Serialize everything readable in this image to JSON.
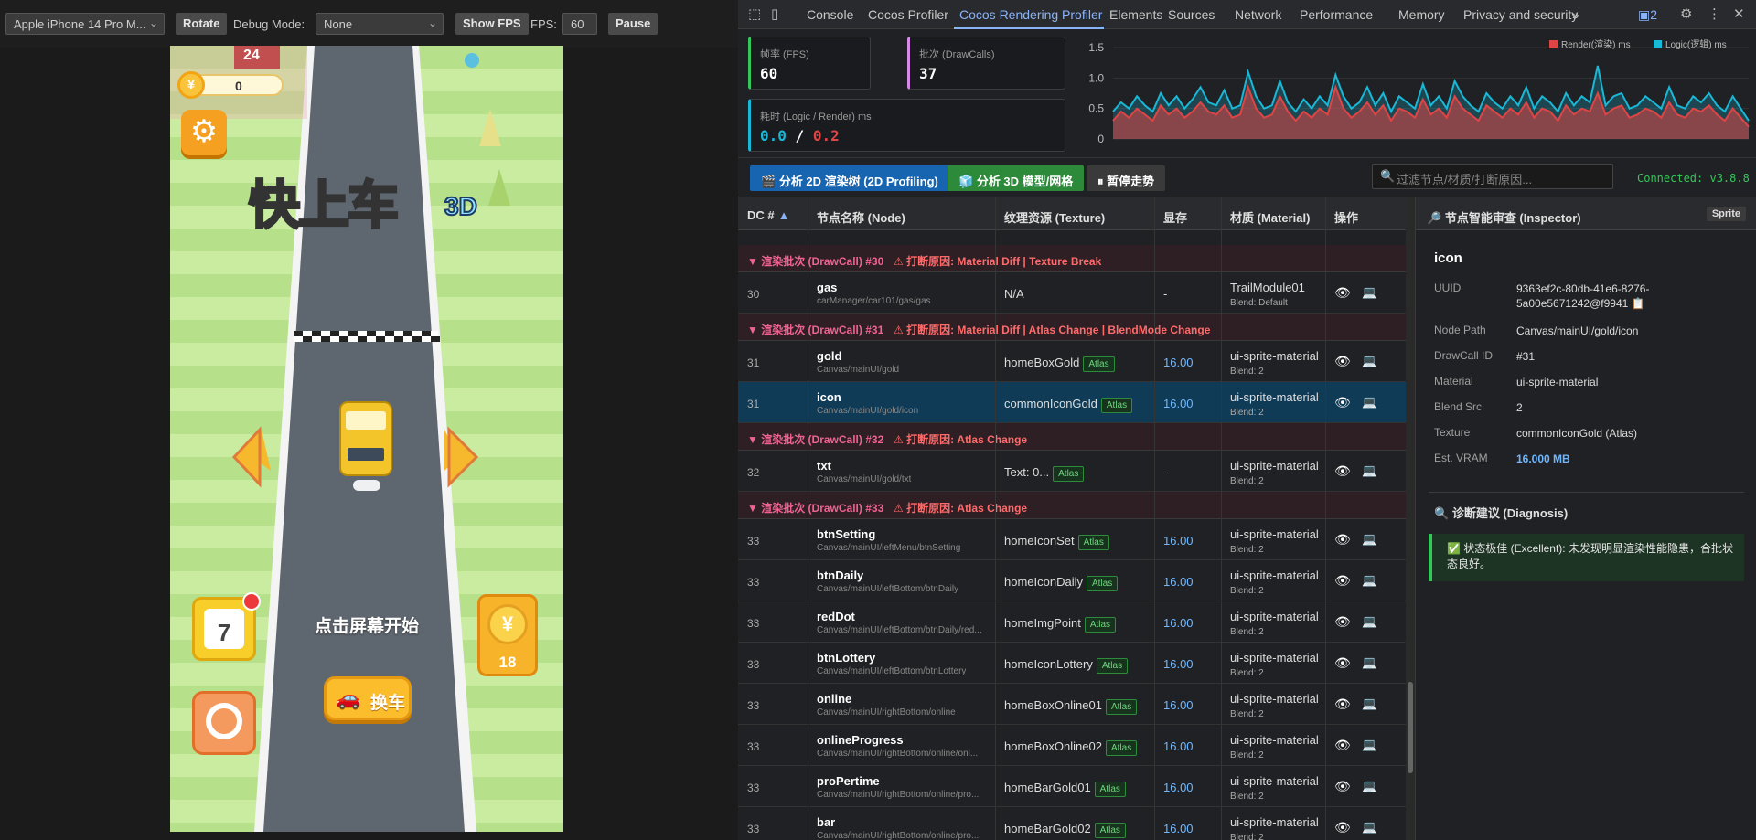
{
  "simulator": {
    "device": "Apple iPhone 14 Pro M...",
    "rotate_label": "Rotate",
    "debug_label": "Debug Mode:",
    "debug_value": "None",
    "show_fps_label": "Show FPS",
    "fps_label": "FPS:",
    "fps_value": "60",
    "pause_label": "Pause"
  },
  "game": {
    "coins": "0",
    "coin_symbol": "¥",
    "title": "快上车",
    "title_3d": "3D",
    "start_tip": "点击屏幕开始",
    "calendar_day": "7",
    "coin_panel_count": "18",
    "change_car_label": "换车",
    "building_number": "24"
  },
  "devtools": {
    "tabs": [
      "Console",
      "Cocos Profiler",
      "Cocos Rendering Profiler",
      "Elements",
      "Sources",
      "Network",
      "Performance",
      "Memory",
      "Privacy and security"
    ],
    "more": "»",
    "issues_count": "2",
    "metrics": {
      "fps_label": "帧率 (FPS)",
      "fps_value": "60",
      "dc_label": "批次 (DrawCalls)",
      "dc_value": "37",
      "time_label": "耗时 (Logic / Render) ms",
      "logic_value": "0.0",
      "sep": "/",
      "render_value": "0.2"
    },
    "chart_legend": {
      "render": "Render(渲染) ms",
      "logic": "Logic(逻辑) ms"
    },
    "toolbar": {
      "btn_2d": "分析 2D 渲染树 (2D Profiling)",
      "btn_3d": "分析 3D 模型/网格",
      "btn_pause": "暂停走势",
      "filter_placeholder": "过滤节点/材质/打断原因...",
      "connected": "Connected: v3.8.8"
    },
    "table": {
      "headers": [
        "DC #",
        "节点名称 (Node)",
        "纹理资源 (Texture)",
        "显存",
        "材质 (Material)",
        "操作"
      ],
      "sort_arrow": "▲",
      "atlas_tag": "Atlas",
      "groups": [
        {
          "title": "▼ 渲染批次 (DrawCall) #30",
          "reason": "⚠ 打断原因: Material Diff | Texture Break",
          "rows": [
            {
              "dc": "30",
              "name": "gas",
              "path": "carManager/car101/gas/gas",
              "texture": "N/A",
              "atlas": false,
              "vram": "-",
              "material": "TrailModule01",
              "blend": "Blend: Default"
            }
          ]
        },
        {
          "title": "▼ 渲染批次 (DrawCall) #31",
          "reason": "⚠ 打断原因: Material Diff | Atlas Change | BlendMode Change",
          "rows": [
            {
              "dc": "31",
              "name": "gold",
              "path": "Canvas/mainUI/gold",
              "texture": "homeBoxGold",
              "atlas": true,
              "vram": "16.00",
              "material": "ui-sprite-material",
              "blend": "Blend: 2"
            },
            {
              "dc": "31",
              "name": "icon",
              "path": "Canvas/mainUI/gold/icon",
              "texture": "commonIconGold",
              "atlas": true,
              "vram": "16.00",
              "material": "ui-sprite-material",
              "blend": "Blend: 2",
              "selected": true
            }
          ]
        },
        {
          "title": "▼ 渲染批次 (DrawCall) #32",
          "reason": "⚠ 打断原因: Atlas Change",
          "rows": [
            {
              "dc": "32",
              "name": "txt",
              "path": "Canvas/mainUI/gold/txt",
              "texture": "Text: 0...",
              "atlas": true,
              "vram": "-",
              "material": "ui-sprite-material",
              "blend": "Blend: 2"
            }
          ]
        },
        {
          "title": "▼ 渲染批次 (DrawCall) #33",
          "reason": "⚠ 打断原因: Atlas Change",
          "rows": [
            {
              "dc": "33",
              "name": "btnSetting",
              "path": "Canvas/mainUI/leftMenu/btnSetting",
              "texture": "homeIconSet",
              "atlas": true,
              "vram": "16.00",
              "material": "ui-sprite-material",
              "blend": "Blend: 2"
            },
            {
              "dc": "33",
              "name": "btnDaily",
              "path": "Canvas/mainUI/leftBottom/btnDaily",
              "texture": "homeIconDaily",
              "atlas": true,
              "vram": "16.00",
              "material": "ui-sprite-material",
              "blend": "Blend: 2"
            },
            {
              "dc": "33",
              "name": "redDot",
              "path": "Canvas/mainUI/leftBottom/btnDaily/red...",
              "texture": "homeImgPoint",
              "atlas": true,
              "vram": "16.00",
              "material": "ui-sprite-material",
              "blend": "Blend: 2"
            },
            {
              "dc": "33",
              "name": "btnLottery",
              "path": "Canvas/mainUI/leftBottom/btnLottery",
              "texture": "homeIconLottery",
              "atlas": true,
              "vram": "16.00",
              "material": "ui-sprite-material",
              "blend": "Blend: 2"
            },
            {
              "dc": "33",
              "name": "online",
              "path": "Canvas/mainUI/rightBottom/online",
              "texture": "homeBoxOnline01",
              "atlas": true,
              "vram": "16.00",
              "material": "ui-sprite-material",
              "blend": "Blend: 2"
            },
            {
              "dc": "33",
              "name": "onlineProgress",
              "path": "Canvas/mainUI/rightBottom/online/onl...",
              "texture": "homeBoxOnline02",
              "atlas": true,
              "vram": "16.00",
              "material": "ui-sprite-material",
              "blend": "Blend: 2"
            },
            {
              "dc": "33",
              "name": "proPertime",
              "path": "Canvas/mainUI/rightBottom/online/pro...",
              "texture": "homeBarGold01",
              "atlas": true,
              "vram": "16.00",
              "material": "ui-sprite-material",
              "blend": "Blend: 2"
            },
            {
              "dc": "33",
              "name": "bar",
              "path": "Canvas/mainUI/rightBottom/online/pro...",
              "texture": "homeBarGold02",
              "atlas": true,
              "vram": "16.00",
              "material": "ui-sprite-material",
              "blend": "Blend: 2"
            }
          ]
        }
      ]
    },
    "inspector": {
      "title": "节点智能审查 (Inspector)",
      "badge": "Sprite",
      "node_name": "icon",
      "fields": [
        {
          "k": "UUID",
          "v": "9363ef2c-80db-41e6-8276-5a00e5671242@f9941 📋"
        },
        {
          "k": "Node Path",
          "v": "Canvas/mainUI/gold/icon"
        },
        {
          "k": "DrawCall ID",
          "v": "#31"
        },
        {
          "k": "Material",
          "v": "ui-sprite-material"
        },
        {
          "k": "Blend Src",
          "v": "2"
        },
        {
          "k": "Texture",
          "v": "commonIconGold (Atlas)"
        },
        {
          "k": "Est. VRAM",
          "v": "16.000 MB",
          "blue": true
        }
      ],
      "diag_title": "诊断建议 (Diagnosis)",
      "diag_text": "✅ 状态极佳 (Excellent): 未发现明显渲染性能隐患，合批状态良好。"
    },
    "colors": {
      "render": "#e04545",
      "logic": "#19b8d6",
      "accent": "#8ab4f8"
    }
  },
  "chart_data": {
    "type": "area",
    "title": "",
    "ylim": [
      0,
      1.5
    ],
    "yticks": [
      "1.5",
      "1.0",
      "0.5",
      "0"
    ],
    "series": [
      {
        "name": "Render(渲染) ms",
        "values": [
          0.3,
          0.45,
          0.35,
          0.5,
          0.4,
          0.3,
          0.55,
          0.4,
          0.5,
          0.35,
          0.45,
          0.6,
          0.45,
          0.4,
          0.55,
          0.35,
          0.4,
          0.85,
          0.5,
          0.35,
          0.4,
          0.7,
          0.45,
          0.3,
          0.45,
          0.35,
          0.5,
          0.4,
          0.85,
          0.5,
          0.35,
          0.45,
          0.6,
          0.4,
          0.55,
          0.3,
          0.5,
          0.45,
          0.35,
          0.65,
          0.4,
          0.5,
          0.35,
          0.7,
          0.5,
          0.4,
          0.3,
          0.55,
          0.45,
          0.35,
          0.5,
          0.4,
          0.6,
          0.35,
          0.5,
          0.45,
          0.3,
          0.55,
          0.4,
          0.5,
          0.45,
          0.75,
          0.4,
          0.5,
          0.55,
          0.35,
          0.4,
          0.5,
          0.45,
          0.35,
          0.6,
          0.4,
          0.35,
          0.5,
          0.45,
          0.55,
          0.4,
          0.3,
          0.5,
          0.35,
          0.2
        ]
      },
      {
        "name": "Logic(逻辑) ms",
        "values": [
          0.45,
          0.6,
          0.5,
          0.7,
          0.55,
          0.45,
          0.75,
          0.55,
          0.7,
          0.5,
          0.65,
          0.85,
          0.6,
          0.55,
          0.8,
          0.5,
          0.55,
          1.1,
          0.7,
          0.5,
          0.55,
          0.95,
          0.6,
          0.45,
          0.65,
          0.5,
          0.7,
          0.55,
          1.05,
          0.7,
          0.5,
          0.6,
          0.85,
          0.55,
          0.75,
          0.45,
          0.7,
          0.6,
          0.5,
          0.9,
          0.55,
          0.7,
          0.5,
          0.95,
          0.7,
          0.55,
          0.45,
          0.75,
          0.6,
          0.5,
          0.7,
          0.55,
          0.85,
          0.5,
          0.7,
          0.6,
          0.45,
          0.75,
          0.55,
          0.7,
          0.6,
          1.2,
          0.55,
          0.7,
          0.75,
          0.5,
          0.55,
          0.7,
          0.6,
          0.5,
          0.85,
          0.55,
          0.5,
          0.7,
          0.6,
          0.75,
          0.55,
          0.45,
          0.7,
          0.5,
          0.3
        ]
      }
    ]
  }
}
